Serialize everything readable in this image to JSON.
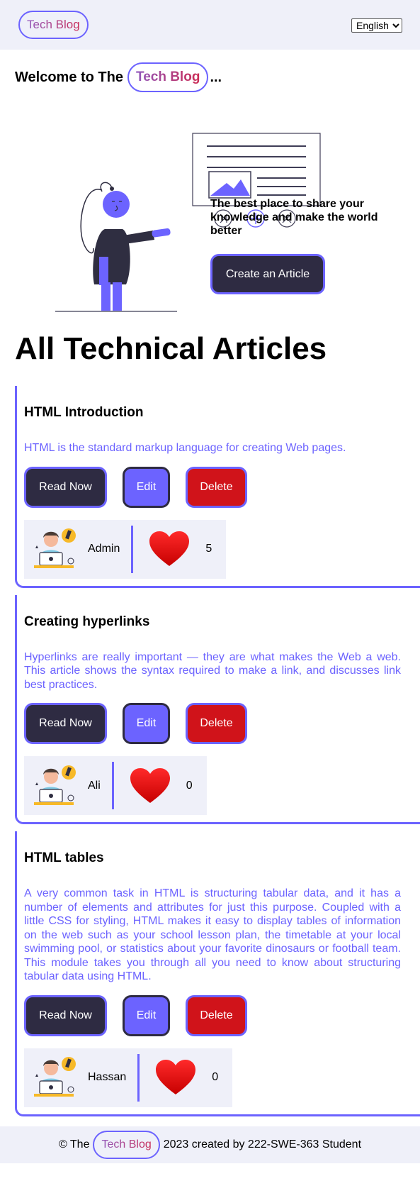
{
  "navbar": {
    "brand": "Tech Blog",
    "language": {
      "selected": "English",
      "options": [
        "English"
      ]
    }
  },
  "hero": {
    "welcome_prefix": "Welcome to The",
    "welcome_brand": "Tech Blog",
    "welcome_suffix": "...",
    "tagline": "The best place to share your knowledge and make the world better",
    "create_label": "Create an Article"
  },
  "articles_title": "All Technical Articles",
  "buttons": {
    "read": "Read Now",
    "edit": "Edit",
    "delete": "Delete"
  },
  "articles": [
    {
      "title": "HTML Introduction",
      "desc": "HTML is the standard markup language for creating Web pages.",
      "author": "Admin",
      "likes": "5"
    },
    {
      "title": "Creating hyperlinks",
      "desc": "Hyperlinks are really important — they are what makes the Web a web. This article shows the syntax required to make a link, and discusses link best practices.",
      "author": "Ali",
      "likes": "0"
    },
    {
      "title": "HTML tables",
      "desc": "A very common task in HTML is structuring tabular data, and it has a number of elements and attributes for just this purpose. Coupled with a little CSS for styling, HTML makes it easy to display tables of information on the web such as your school lesson plan, the timetable at your local swimming pool, or statistics about your favorite dinosaurs or football team. This module takes you through all you need to know about structuring tabular data using HTML.",
      "author": "Hassan",
      "likes": "0"
    }
  ],
  "footer": {
    "prefix": "© The",
    "brand": "Tech Blog",
    "suffix": "2023 created by 222-SWE-363 Student"
  },
  "colors": {
    "accent": "#6c63ff",
    "dark": "#2e2b42",
    "danger": "#d0131a",
    "panel": "#eff0f9"
  },
  "icons": {
    "illustration": "woman-pointing-at-article-illustration",
    "avatar": "developer-avatar-icon",
    "like": "heart-icon"
  }
}
